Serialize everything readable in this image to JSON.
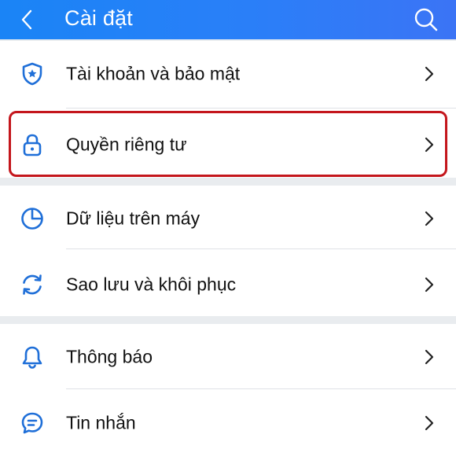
{
  "header": {
    "title": "Cài đặt",
    "back_icon": "chevron-left-icon",
    "search_icon": "search-icon",
    "background_color": "#1a84f6"
  },
  "groups": [
    {
      "items": [
        {
          "label": "Tài khoản và bảo mật",
          "icon": "shield-icon"
        },
        {
          "label": "Quyền riêng tư",
          "icon": "lock-icon",
          "highlighted": true
        }
      ]
    },
    {
      "items": [
        {
          "label": "Dữ liệu trên máy",
          "icon": "pie-chart-icon"
        },
        {
          "label": "Sao lưu và khôi phục",
          "icon": "sync-icon"
        }
      ]
    },
    {
      "items": [
        {
          "label": "Thông báo",
          "icon": "bell-icon"
        },
        {
          "label": "Tin nhắn",
          "icon": "chat-icon"
        }
      ]
    }
  ],
  "colors": {
    "accent": "#1f6fd8",
    "highlight_border": "#c4161c",
    "separator": "#e9ecef"
  }
}
